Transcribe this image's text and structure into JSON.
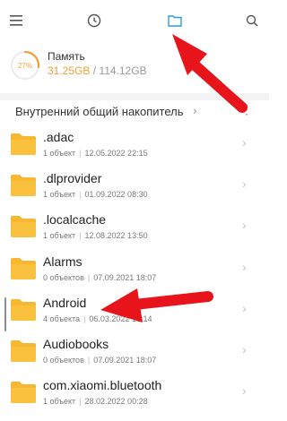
{
  "toolbar": {
    "menu_icon": "menu-icon",
    "recent_icon": "clock-icon",
    "folder_icon": "folder-icon",
    "search_icon": "search-icon",
    "active_color": "#2d9cdb"
  },
  "storage": {
    "percent_label": "27%",
    "percent_value": 27,
    "title": "Память",
    "used": "31.25GB",
    "separator": "/",
    "total": "114.12GB",
    "accent": "#f0a033"
  },
  "path": {
    "label": "Внутренний общий накопитель",
    "chevron": "›",
    "more": "⋮"
  },
  "files": [
    {
      "name": ".adac",
      "count": "1 объект",
      "date": "12.05.2022 22:15"
    },
    {
      "name": ".dlprovider",
      "count": "1 объект",
      "date": "01.09.2022 08:30"
    },
    {
      "name": ".localcache",
      "count": "1 объект",
      "date": "12.08.2022 13:50"
    },
    {
      "name": "Alarms",
      "count": "0 объектов",
      "date": "07.09.2021 18:07"
    },
    {
      "name": "Android",
      "count": "4 объекта",
      "date": "06.03.2022 18:14"
    },
    {
      "name": "Audiobooks",
      "count": "0 объектов",
      "date": "07.09.2021 18:07"
    },
    {
      "name": "com.xiaomi.bluetooth",
      "count": "1 объект",
      "date": "28.02.2022 00:28"
    }
  ],
  "row_chevron": "›",
  "annotation": {
    "arrow_color": "#e8141c"
  }
}
